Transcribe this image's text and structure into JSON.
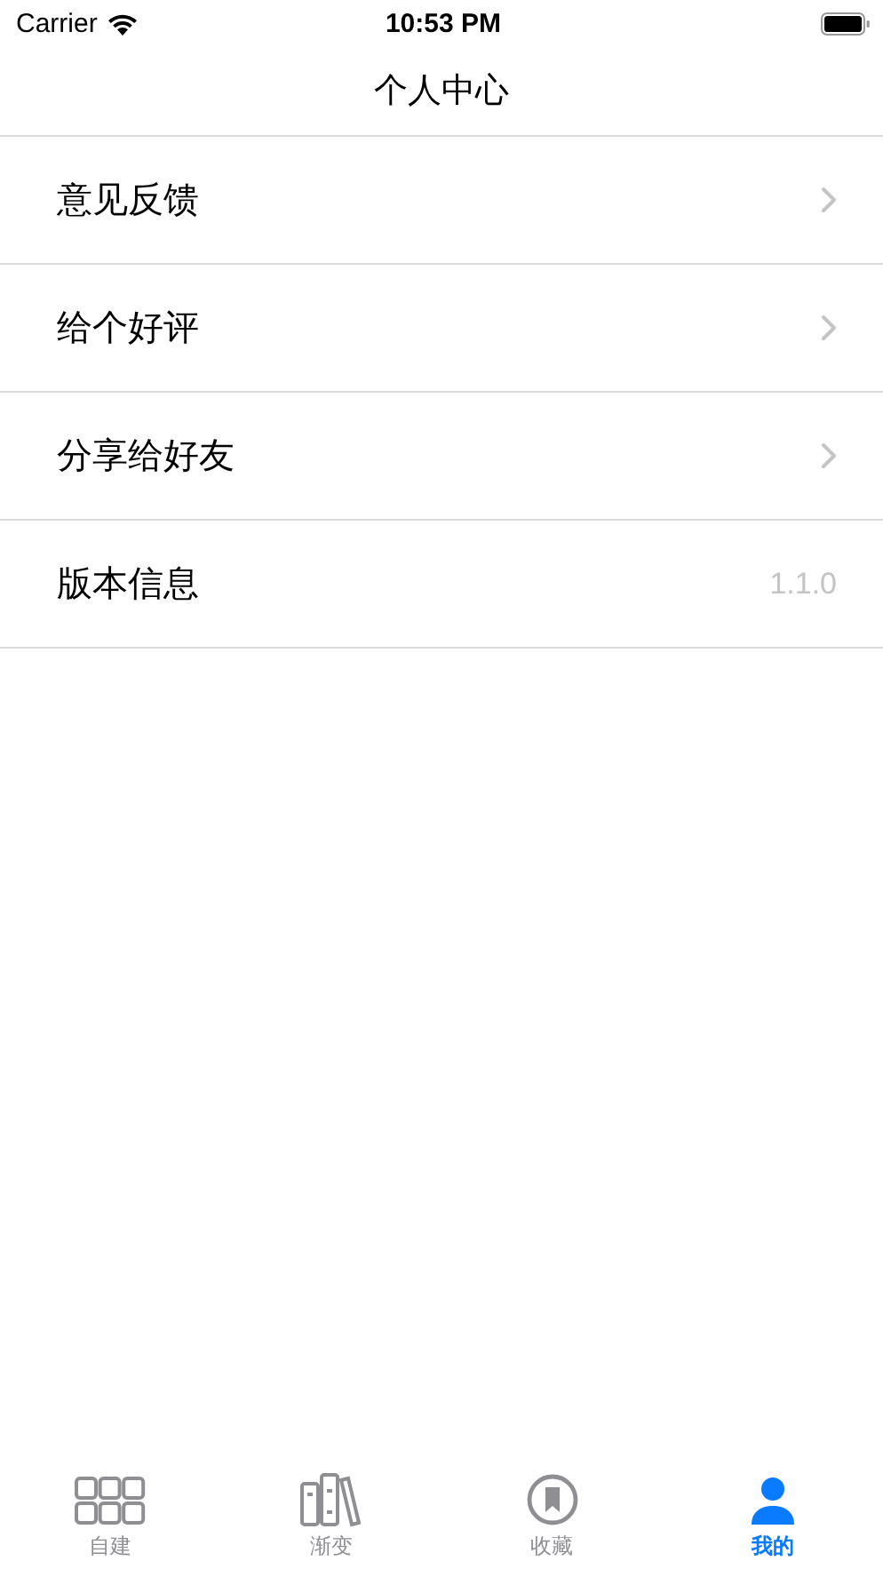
{
  "status_bar": {
    "carrier": "Carrier",
    "time": "10:53 PM"
  },
  "nav": {
    "title": "个人中心"
  },
  "rows": [
    {
      "kind": "link",
      "label": "意见反馈"
    },
    {
      "kind": "link",
      "label": "给个好评"
    },
    {
      "kind": "link",
      "label": "分享给好友"
    },
    {
      "kind": "info",
      "label": "版本信息",
      "value": "1.1.0"
    }
  ],
  "tabs": [
    {
      "kind": "grid",
      "label": "自建",
      "selected": false
    },
    {
      "kind": "books",
      "label": "渐变",
      "selected": false
    },
    {
      "kind": "bookmark",
      "label": "收藏",
      "selected": false
    },
    {
      "kind": "person",
      "label": "我的",
      "selected": true
    }
  ]
}
